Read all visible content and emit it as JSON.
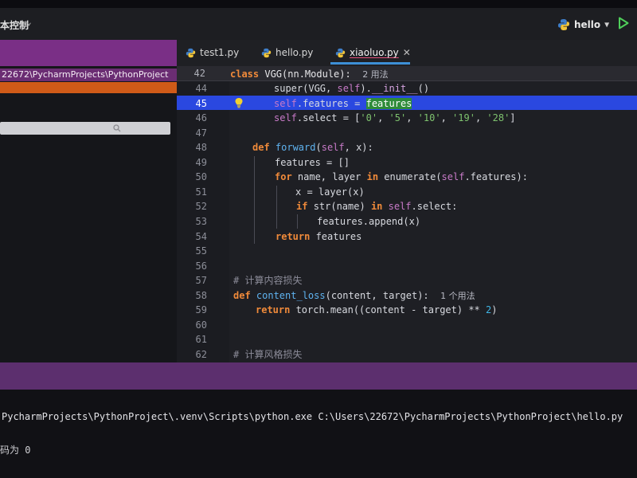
{
  "toolbar": {
    "vcs_label": "本控制",
    "run_config": "hello"
  },
  "project": {
    "path": "22672\\PycharmProjects\\PythonProject"
  },
  "tabs": [
    {
      "label": "test1.py",
      "active": false
    },
    {
      "label": "hello.py",
      "active": false
    },
    {
      "label": "xiaoluo.py",
      "active": true
    }
  ],
  "sticky": {
    "line": "42",
    "code": {
      "kw": "class ",
      "name": "VGG(nn.Module):",
      "hint": "2 用法"
    }
  },
  "editor": {
    "current_line": "45",
    "lines": [
      {
        "n": "44",
        "tokens": [
          [
            "plain",
            "super(VGG, "
          ],
          [
            "self",
            "self"
          ],
          [
            "plain",
            ")."
          ],
          [
            "dunder",
            "__init__"
          ],
          [
            "plain",
            "()"
          ]
        ]
      },
      {
        "n": "45",
        "tokens": [
          [
            "self",
            "self"
          ],
          [
            "plain",
            ".features = "
          ],
          [
            "match",
            "features"
          ]
        ]
      },
      {
        "n": "46",
        "tokens": [
          [
            "self",
            "self"
          ],
          [
            "plain",
            ".select = ["
          ],
          [
            "str",
            "'0'"
          ],
          [
            "plain",
            ", "
          ],
          [
            "str",
            "'5'"
          ],
          [
            "plain",
            ", "
          ],
          [
            "str",
            "'10'"
          ],
          [
            "plain",
            ", "
          ],
          [
            "str",
            "'19'"
          ],
          [
            "plain",
            ", "
          ],
          [
            "str",
            "'28'"
          ],
          [
            "plain",
            "]"
          ]
        ]
      },
      {
        "n": "47",
        "tokens": []
      },
      {
        "n": "48",
        "tokens": [
          [
            "kw",
            "def "
          ],
          [
            "fn",
            "forward"
          ],
          [
            "plain",
            "("
          ],
          [
            "self",
            "self"
          ],
          [
            "plain",
            ", x):"
          ]
        ]
      },
      {
        "n": "49",
        "tokens": [
          [
            "plain",
            "features = []"
          ]
        ]
      },
      {
        "n": "50",
        "tokens": [
          [
            "kw",
            "for "
          ],
          [
            "plain",
            "name, layer "
          ],
          [
            "kw",
            "in "
          ],
          [
            "plain",
            "enumerate("
          ],
          [
            "self",
            "self"
          ],
          [
            "plain",
            ".features):"
          ]
        ]
      },
      {
        "n": "51",
        "tokens": [
          [
            "plain",
            "x = layer(x)"
          ]
        ]
      },
      {
        "n": "52",
        "tokens": [
          [
            "kw",
            "if "
          ],
          [
            "plain",
            "str(name) "
          ],
          [
            "kw",
            "in "
          ],
          [
            "self",
            "self"
          ],
          [
            "plain",
            ".select:"
          ]
        ]
      },
      {
        "n": "53",
        "tokens": [
          [
            "plain",
            "features.append(x)"
          ]
        ]
      },
      {
        "n": "54",
        "tokens": [
          [
            "kw",
            "return "
          ],
          [
            "plain",
            "features"
          ]
        ]
      },
      {
        "n": "55",
        "tokens": []
      },
      {
        "n": "56",
        "tokens": []
      },
      {
        "n": "57",
        "tokens": [
          [
            "cm",
            "# 计算内容损失"
          ]
        ]
      },
      {
        "n": "58",
        "tokens": [
          [
            "kw",
            "def "
          ],
          [
            "fn",
            "content_loss"
          ],
          [
            "plain",
            "(content, target):  "
          ],
          [
            "hint",
            "1 个用法"
          ]
        ]
      },
      {
        "n": "59",
        "tokens": [
          [
            "kw",
            "return "
          ],
          [
            "plain",
            "torch.mean((content - target) ** "
          ],
          [
            "num",
            "2"
          ],
          [
            "plain",
            ")"
          ]
        ]
      },
      {
        "n": "60",
        "tokens": []
      },
      {
        "n": "61",
        "tokens": []
      },
      {
        "n": "62",
        "tokens": [
          [
            "cm",
            "# 计算风格损失"
          ]
        ]
      }
    ]
  },
  "console": {
    "command": "PycharmProjects\\PythonProject\\.venv\\Scripts\\python.exe C:\\Users\\22672\\PycharmProjects\\PythonProject\\hello.py",
    "exit": "码为 0"
  },
  "colors": {
    "accent_purple": "#5c2f6e",
    "current_line": "#2a48e0",
    "selection": "#cf5a18"
  }
}
